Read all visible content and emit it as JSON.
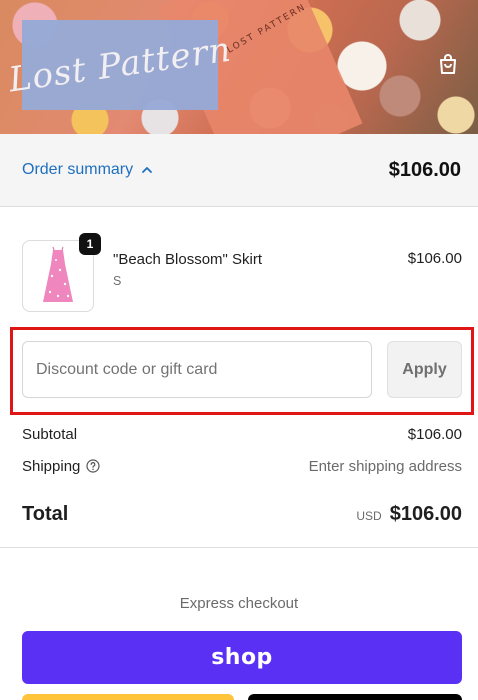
{
  "banner": {
    "logo_text": "Lost Pattern",
    "stamp_text": "LOST PATTERN",
    "cart_icon": "shopping-bag-icon"
  },
  "summary": {
    "label": "Order summary",
    "total": "$106.00",
    "chevron_icon": "chevron-up-icon"
  },
  "product": {
    "name": "\"Beach Blossom\" Skirt",
    "variant": "S",
    "price": "$106.00",
    "quantity": "1"
  },
  "discount": {
    "placeholder": "Discount code or gift card",
    "apply_label": "Apply"
  },
  "totals": {
    "subtotal_label": "Subtotal",
    "subtotal_value": "$106.00",
    "shipping_label": "Shipping",
    "shipping_value": "Enter shipping address",
    "total_label": "Total",
    "currency": "USD",
    "total_value": "$106.00"
  },
  "express": {
    "label": "Express checkout",
    "shop_label": "shop"
  },
  "colors": {
    "accent_link": "#1f6fbf",
    "shop_purple": "#5a31f4",
    "highlight_red": "#e01515",
    "logo_block": "#97aad6"
  }
}
